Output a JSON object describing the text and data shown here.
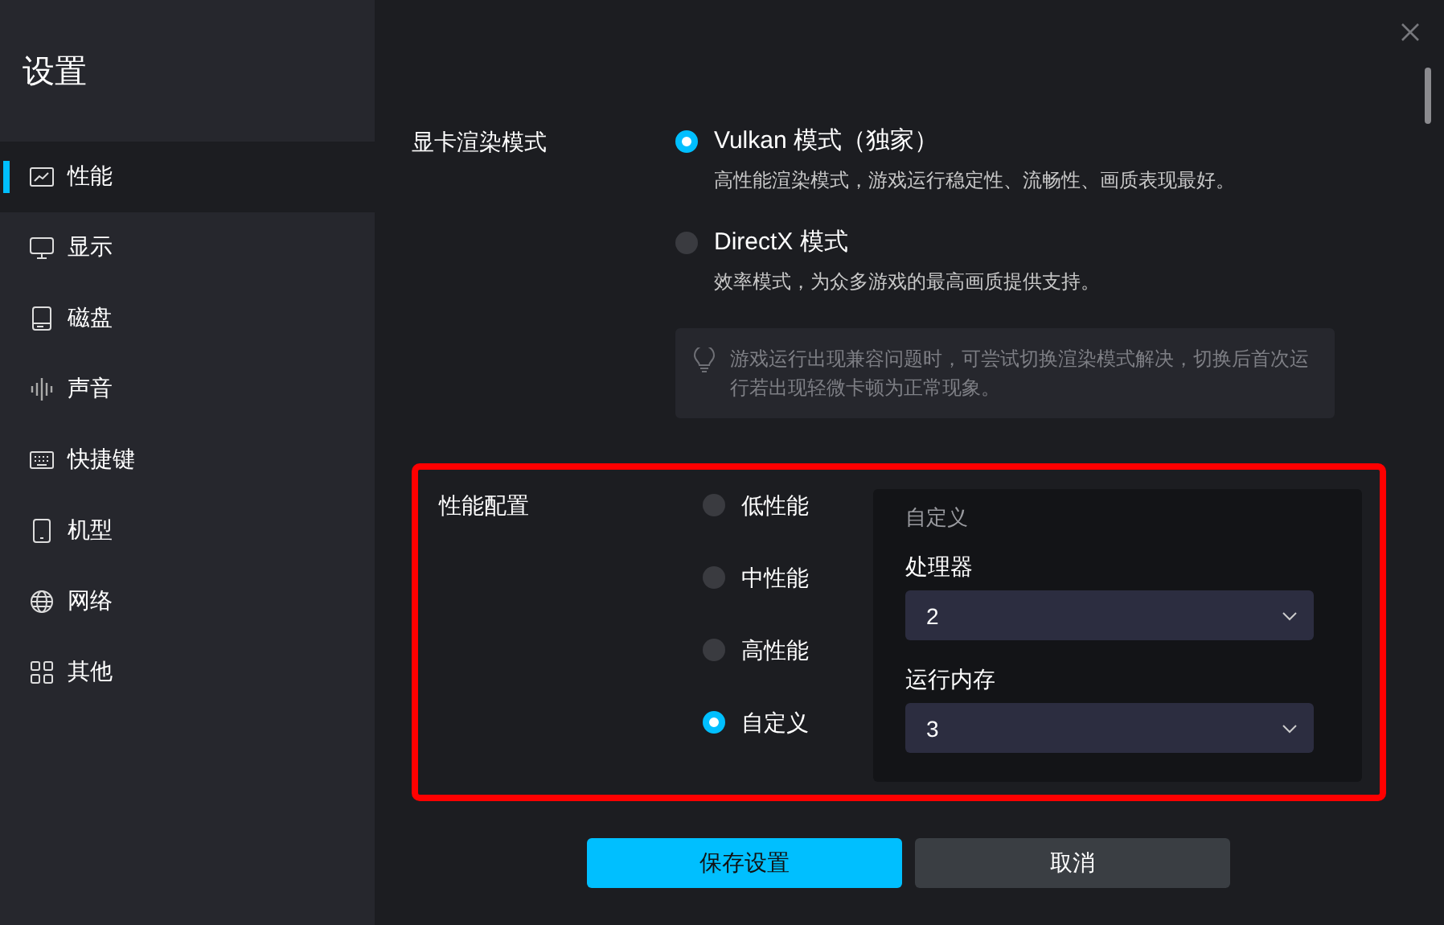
{
  "sidebar": {
    "title": "设置",
    "items": [
      {
        "label": "性能",
        "selected": true
      },
      {
        "label": "显示",
        "selected": false
      },
      {
        "label": "磁盘",
        "selected": false
      },
      {
        "label": "声音",
        "selected": false
      },
      {
        "label": "快捷键",
        "selected": false
      },
      {
        "label": "机型",
        "selected": false
      },
      {
        "label": "网络",
        "selected": false
      },
      {
        "label": "其他",
        "selected": false
      }
    ]
  },
  "render_mode": {
    "label": "显卡渲染模式",
    "options": [
      {
        "label": "Vulkan 模式（独家）",
        "description": "高性能渲染模式，游戏运行稳定性、流畅性、画质表现最好。",
        "selected": true
      },
      {
        "label": "DirectX 模式",
        "description": "效率模式，为众多游戏的最高画质提供支持。",
        "selected": false
      }
    ],
    "tip": "游戏运行出现兼容问题时，可尝试切换渲染模式解决，切换后首次运行若出现轻微卡顿为正常现象。"
  },
  "performance": {
    "label": "性能配置",
    "highlighted": true,
    "options": [
      {
        "label": "低性能",
        "selected": false
      },
      {
        "label": "中性能",
        "selected": false
      },
      {
        "label": "高性能",
        "selected": false
      },
      {
        "label": "自定义",
        "selected": true
      }
    ],
    "custom_panel": {
      "title": "自定义",
      "fields": [
        {
          "label": "处理器",
          "value": "2"
        },
        {
          "label": "运行内存",
          "value": "3"
        }
      ]
    }
  },
  "buttons": [
    {
      "label": "保存设置",
      "kind": "primary"
    },
    {
      "label": "取消",
      "kind": "secondary"
    }
  ]
}
